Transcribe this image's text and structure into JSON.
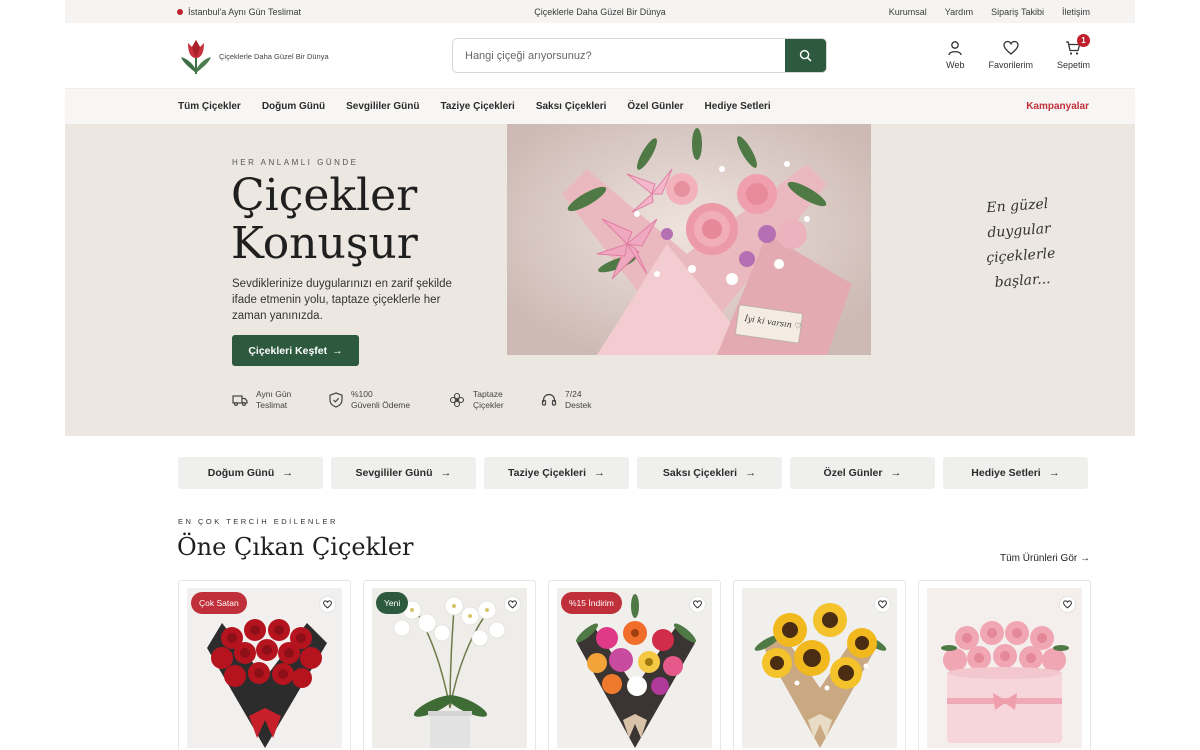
{
  "topbar": {
    "delivery_note": "İstanbul'a Aynı Gün Teslimat",
    "slogan": "Çiçeklerle Daha Güzel Bir Dünya",
    "links": [
      "Kurumsal",
      "Yardım",
      "Sipariş Takibi",
      "İletişim"
    ]
  },
  "header": {
    "logo_tagline": "Çiçeklerle Daha Güzel Bir Dünya",
    "search_placeholder": "Hangi çiçeği arıyorsunuz?",
    "account_label": "Web",
    "favorites_label": "Favorilerim",
    "cart_label": "Sepetim",
    "cart_count": "1"
  },
  "nav": {
    "items": [
      "Tüm Çiçekler",
      "Doğum Günü",
      "Sevgililer Günü",
      "Taziye Çiçekleri",
      "Saksı Çiçekleri",
      "Özel Günler",
      "Hediye Setleri"
    ],
    "promo": "Kampanyalar"
  },
  "hero": {
    "eyebrow": "HER ANLAMLI GÜNDE",
    "title_line1": "Çiçekler",
    "title_line2": "Konuşur",
    "description": "Sevdiklerinize duygularınızı en zarif şekilde ifade etmenin yolu, taptaze çiçeklerle her zaman yanınızda.",
    "cta": "Çiçekleri Keşfet",
    "card_note": "İyi ki varsın ♡",
    "script_lines": [
      "En güzel",
      "duygular",
      "çiçeklerle",
      "başlar..."
    ],
    "features": [
      {
        "line1": "Aynı Gün",
        "line2": "Teslimat",
        "icon": "truck-icon"
      },
      {
        "line1": "%100",
        "line2": "Güvenli Ödeme",
        "icon": "shield-icon"
      },
      {
        "line1": "Taptaze",
        "line2": "Çiçekler",
        "icon": "flower-icon"
      },
      {
        "line1": "7/24",
        "line2": "Destek",
        "icon": "headset-icon"
      }
    ]
  },
  "categories": [
    "Doğum Günü",
    "Sevgililer Günü",
    "Taziye Çiçekleri",
    "Saksı Çiçekleri",
    "Özel Günler",
    "Hediye Setleri"
  ],
  "featured": {
    "eyebrow": "EN ÇOK TERCİH EDİLENLER",
    "title": "Öne Çıkan Çiçekler",
    "link": "Tüm Ürünleri Gör →",
    "products": [
      {
        "badge": "Çok Satan",
        "badge_color": "#c0303a",
        "image": "red-rose-bouquet"
      },
      {
        "badge": "Yeni",
        "badge_color": "#2d5a3f",
        "image": "white-orchid"
      },
      {
        "badge": "%15 İndirim",
        "badge_color": "#c0303a",
        "image": "mixed-bouquet"
      },
      {
        "badge": "",
        "badge_color": "",
        "image": "sunflower-bouquet"
      },
      {
        "badge": "",
        "badge_color": "",
        "image": "pink-rose-box"
      }
    ]
  },
  "colors": {
    "primary_green": "#2d5a3f",
    "accent_red": "#c0303a",
    "hero_bg": "#ece7e1"
  }
}
